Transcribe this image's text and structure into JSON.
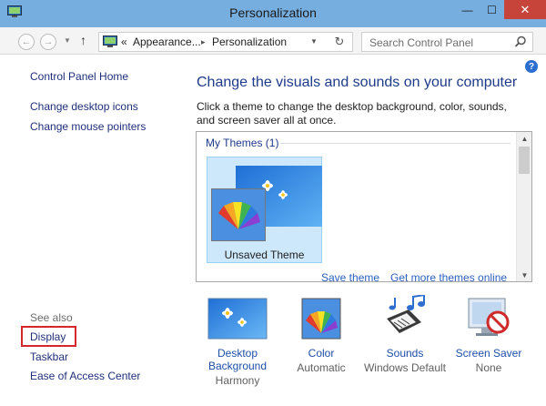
{
  "window": {
    "title": "Personalization",
    "controls": {
      "minimize": "—",
      "maximize": "☐",
      "close": "✕"
    }
  },
  "address": {
    "back_icon": "back-arrow-icon",
    "forward_icon": "forward-arrow-icon",
    "up_icon": "up-arrow-icon",
    "crumbs": [
      "«",
      "Appearance...",
      "▸",
      "Personalization"
    ],
    "search_placeholder": "Search Control Panel"
  },
  "left_nav": {
    "home": "Control Panel Home",
    "links": [
      "Change desktop icons",
      "Change mouse pointers"
    ],
    "see_also_label": "See also",
    "see_also": [
      "Display",
      "Taskbar",
      "Ease of Access Center"
    ]
  },
  "main": {
    "heading": "Change the visuals and sounds on your computer",
    "description": "Click a theme to change the desktop background, color, sounds, and screen saver all at once.",
    "themes_group": "My Themes (1)",
    "theme_tile_label": "Unsaved Theme",
    "save_theme": "Save theme",
    "get_more": "Get more themes online"
  },
  "bottom": {
    "desktop_background": {
      "label1": "Desktop",
      "label2": "Background",
      "sub": "Harmony"
    },
    "color": {
      "label": "Color",
      "sub": "Automatic"
    },
    "sounds": {
      "label": "Sounds",
      "sub": "Windows Default"
    },
    "screen_saver": {
      "label": "Screen Saver",
      "sub": "None"
    }
  },
  "colors": {
    "titlebar": "#77aee0",
    "link": "#1f2f7a",
    "heading": "#1e3b8a",
    "highlight_box": "#d5262c",
    "selected_tile": "#cde8fa"
  }
}
